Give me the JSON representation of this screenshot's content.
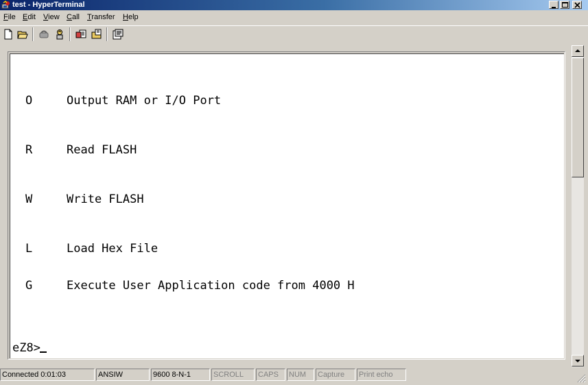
{
  "window": {
    "title": "test - HyperTerminal"
  },
  "menu": [
    {
      "accel": "F",
      "rest": "ile"
    },
    {
      "accel": "E",
      "rest": "dit"
    },
    {
      "accel": "V",
      "rest": "iew"
    },
    {
      "accel": "C",
      "rest": "all"
    },
    {
      "accel": "T",
      "rest": "ransfer"
    },
    {
      "accel": "H",
      "rest": "elp"
    }
  ],
  "toolbar": {
    "icons": [
      "new-document-icon",
      "open-folder-icon",
      "disconnect-icon",
      "connect-phone-icon",
      "send-file-icon",
      "receive-file-icon",
      "properties-icon"
    ]
  },
  "terminal": {
    "lines": [
      {
        "key": "O",
        "text": "Output RAM or I/O Port"
      },
      {
        "key": "R",
        "text": "Read FLASH"
      },
      {
        "key": "W",
        "text": "Write FLASH"
      },
      {
        "key": "L",
        "text": "Load Hex File"
      },
      {
        "key": "G",
        "text": "Execute User Application code from 4000 H"
      }
    ],
    "prompt": "eZ8>"
  },
  "status": {
    "connected": "Connected 0:01:03",
    "emulation": "ANSIW",
    "port_settings": "9600 8-N-1",
    "scroll": "SCROLL",
    "caps": "CAPS",
    "num": "NUM",
    "capture": "Capture",
    "print_echo": "Print echo"
  },
  "colors": {
    "title_active": "#0a246a",
    "chrome": "#d4d0c8",
    "terminal_bg": "#ffffff",
    "terminal_fg": "#000000"
  }
}
